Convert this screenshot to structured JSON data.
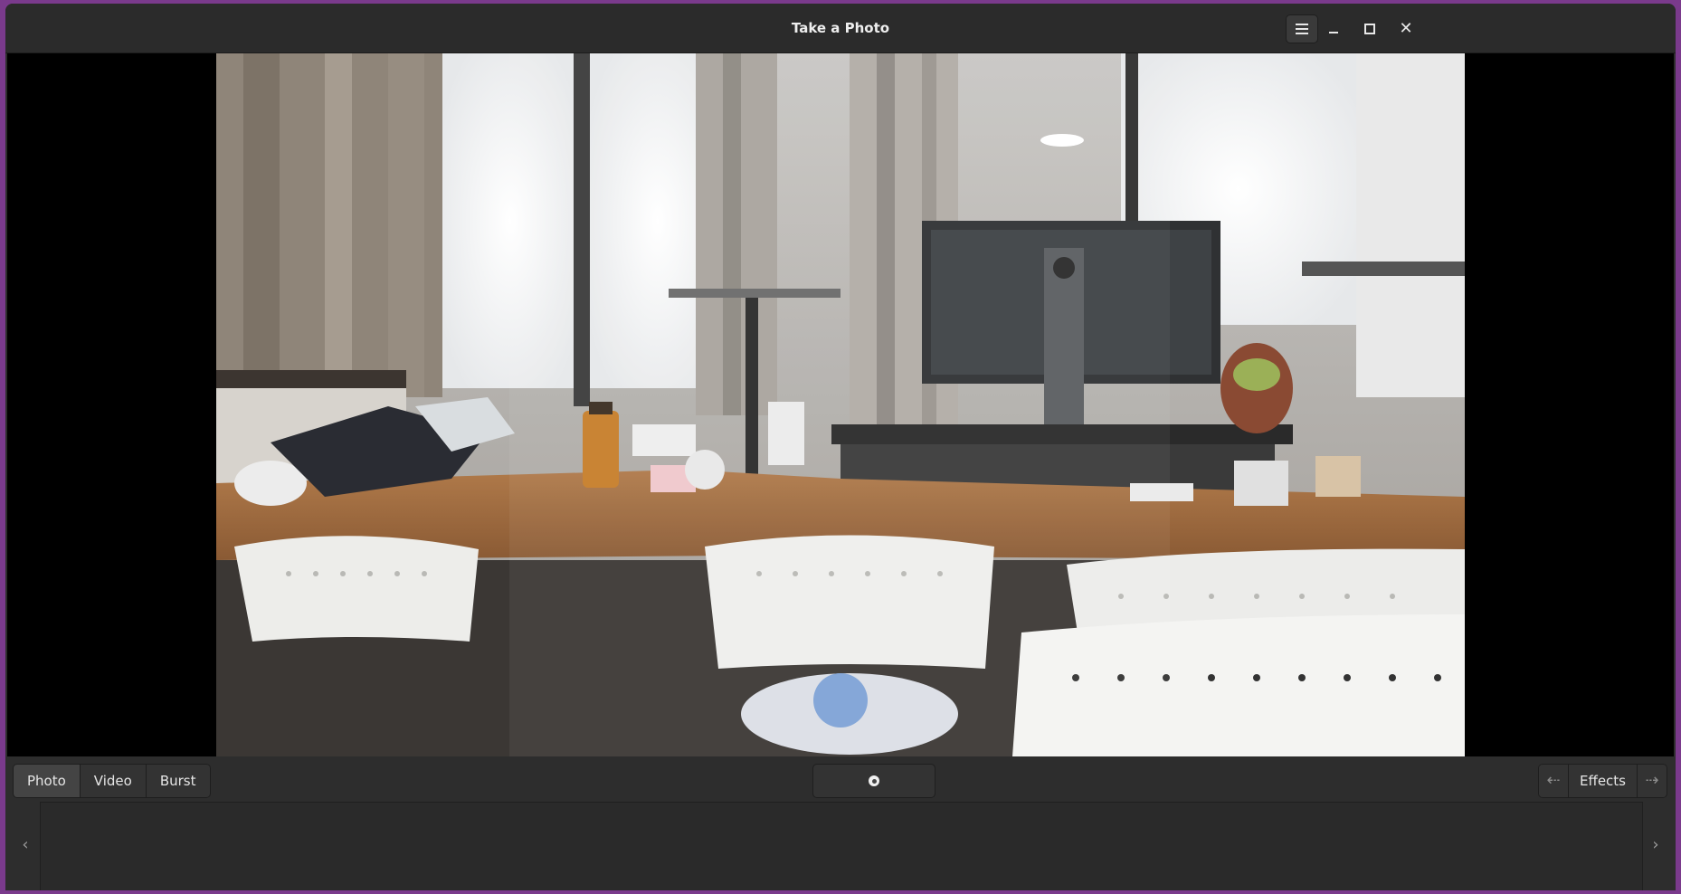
{
  "window": {
    "title": "Take a Photo",
    "controls": {
      "menu_icon": "hamburger-menu-icon",
      "minimize_icon": "minimize-icon",
      "maximize_icon": "maximize-icon",
      "close_icon": "close-icon",
      "close_glyph": "✕"
    }
  },
  "modes": [
    {
      "label": "Photo",
      "active": true
    },
    {
      "label": "Video",
      "active": false
    },
    {
      "label": "Burst",
      "active": false
    }
  ],
  "shutter": {
    "icon": "camera-shutter-icon"
  },
  "effects": {
    "label": "Effects",
    "prev_glyph": "⇠",
    "next_glyph": "⇢"
  },
  "thumbnails": {
    "prev_glyph": "‹",
    "next_glyph": "›"
  },
  "colors": {
    "window_bg": "#2d2d2d",
    "viewport_bg": "#000000",
    "desktop_bg": "#7a3a8c"
  }
}
